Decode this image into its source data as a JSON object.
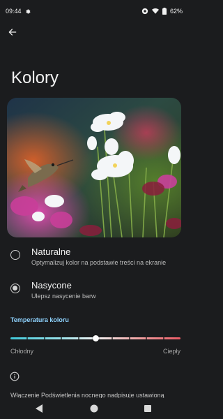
{
  "status_bar": {
    "time": "09:44",
    "battery": "62%",
    "icons": [
      "gear-icon",
      "eye-icon",
      "wifi-icon",
      "battery-icon"
    ]
  },
  "header": {
    "back_icon": "arrow-left-icon",
    "title": "Kolory"
  },
  "hero_image": {
    "description_icon": "hummingbird-flowers-image"
  },
  "options": [
    {
      "title": "Naturalne",
      "subtitle": "Optymalizuj kolor na podstawie treści na ekranie",
      "selected": false
    },
    {
      "title": "Nasycone",
      "subtitle": "Ulepsz nasycenie barw",
      "selected": true
    }
  ],
  "color_temperature": {
    "label": "Temperatura koloru",
    "min_label": "Chłodny",
    "max_label": "Ciepły",
    "value": 0.5,
    "steps": 10,
    "accent": "#8fd3ff"
  },
  "info": {
    "icon": "info-icon",
    "text": "Włączenie Podświetlenia nocnego nadpisuje ustawioną temperaturę barw"
  },
  "nav": {
    "icons": [
      "back-triangle-icon",
      "home-circle-icon",
      "recents-square-icon"
    ]
  }
}
